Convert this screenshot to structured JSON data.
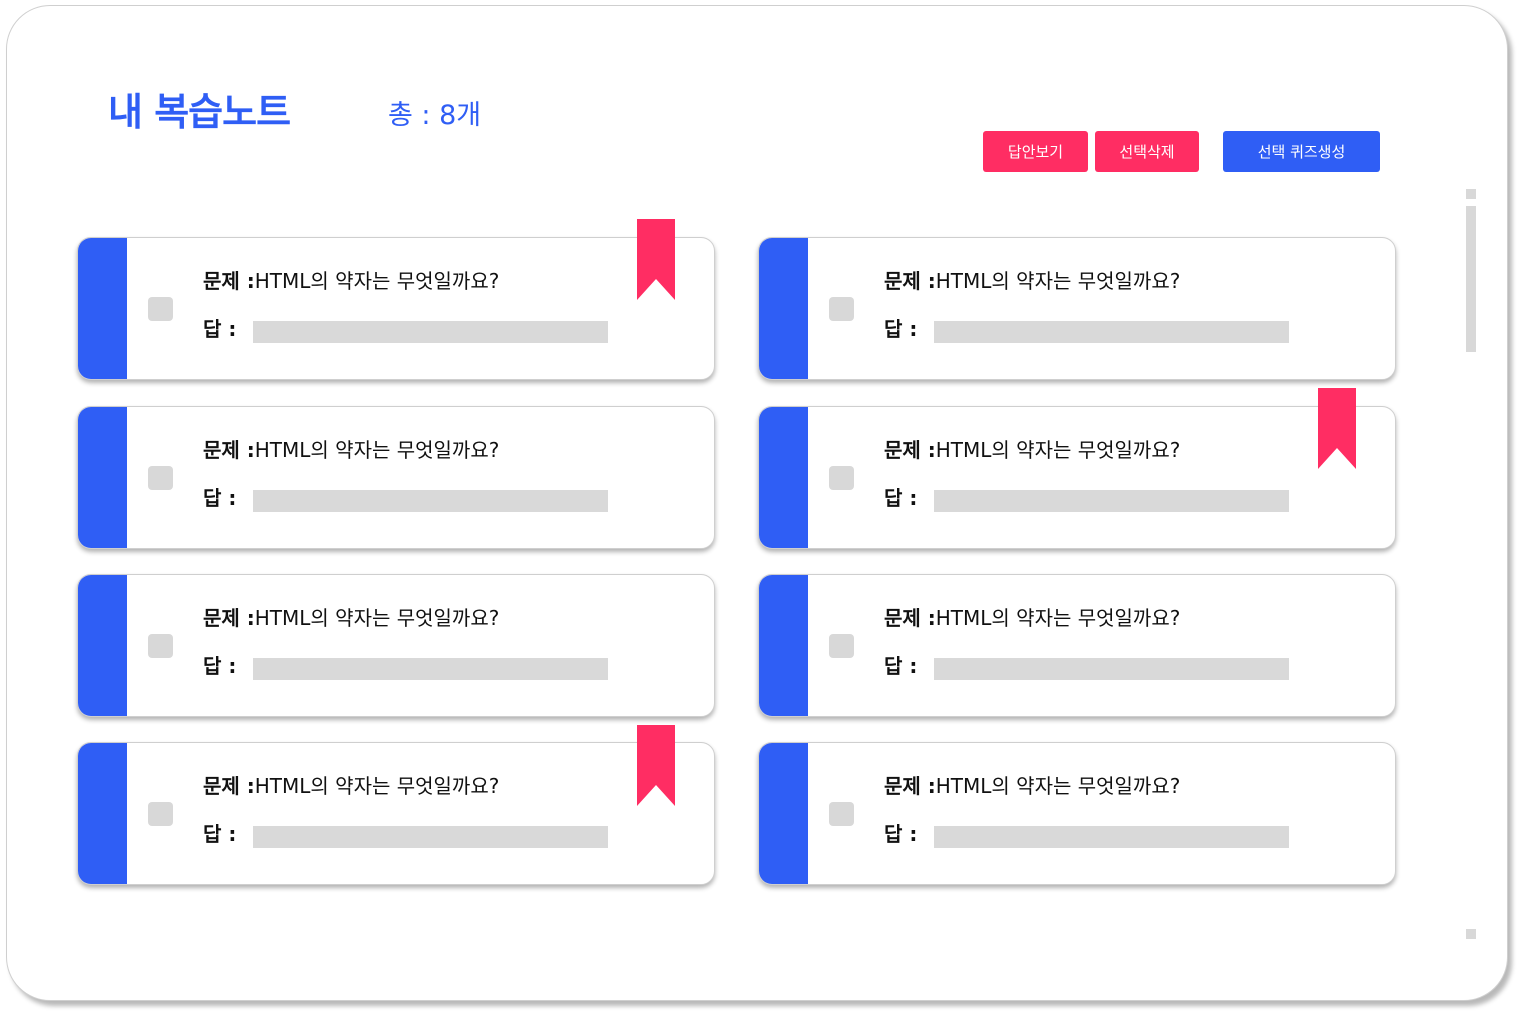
{
  "header": {
    "title": "내 복습노트",
    "total": "총 : 8개"
  },
  "toolbar": {
    "show_answers_label": "답안보기",
    "delete_selected_label": "선택삭제",
    "create_quiz_label": "선택 퀴즈생성"
  },
  "labels": {
    "question_prefix": "문제 :",
    "answer_prefix": "답 :"
  },
  "colors": {
    "accent": "#2f5ef5",
    "bookmark": "#ff2d63",
    "placeholder": "#d9d9d9"
  },
  "cards": [
    {
      "question": "HTML의 약자는 무엇일까요?",
      "bookmarked": true
    },
    {
      "question": "HTML의 약자는 무엇일까요?",
      "bookmarked": false
    },
    {
      "question": "HTML의 약자는 무엇일까요?",
      "bookmarked": false
    },
    {
      "question": "HTML의 약자는 무엇일까요?",
      "bookmarked": true
    },
    {
      "question": "HTML의 약자는 무엇일까요?",
      "bookmarked": false
    },
    {
      "question": "HTML의 약자는 무엇일까요?",
      "bookmarked": false
    },
    {
      "question": "HTML의 약자는 무엇일까요?",
      "bookmarked": true
    },
    {
      "question": "HTML의 약자는 무엇일까요?",
      "bookmarked": false
    }
  ]
}
